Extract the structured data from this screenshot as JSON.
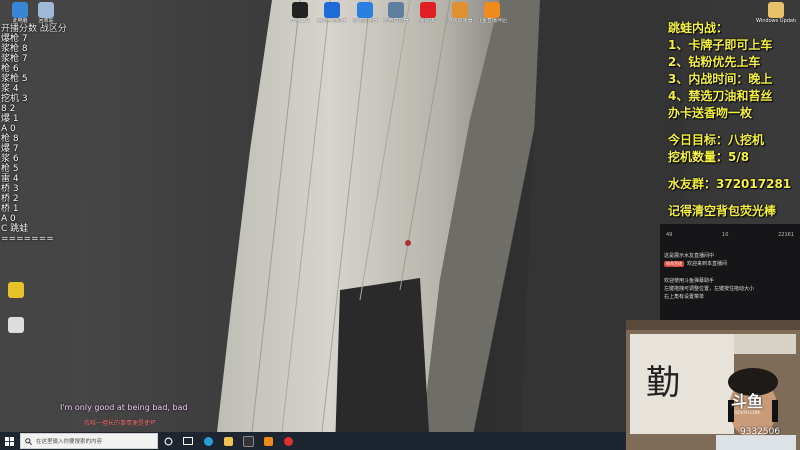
{
  "desktop": {
    "top_icons": [
      {
        "label": "此电脑",
        "color": "#3a86d6",
        "icon": "computer-icon"
      },
      {
        "label": "回收站",
        "color": "#9fb9d4",
        "icon": "recycle-bin-icon"
      },
      {
        "label": "开播工具",
        "color": "#222222",
        "icon": "app-icon"
      },
      {
        "label": "腾讯手游助手",
        "color": "#1e6ad6",
        "icon": "app-icon"
      },
      {
        "label": "雷神加速器",
        "color": "#2b7fe0",
        "icon": "app-icon"
      },
      {
        "label": "雷电模拟器",
        "color": "#5f7fa0",
        "icon": "app-icon"
      },
      {
        "label": "网易UU",
        "color": "#e02020",
        "icon": "app-icon"
      },
      {
        "label": "游戏加速器",
        "color": "#e09030",
        "icon": "app-icon"
      },
      {
        "label": "斗鱼直播伴侣",
        "color": "#f08a1c",
        "icon": "app-icon"
      }
    ],
    "right_icons": [
      {
        "label": "Windows Update 助手",
        "color": "#e8c26a",
        "icon": "folder-icon"
      }
    ],
    "side_icons": [
      {
        "label": "",
        "color": "#e8c22a",
        "icon": "app-icon"
      },
      {
        "label": "",
        "color": "#dddddd",
        "icon": "app-icon"
      }
    ]
  },
  "left_overlay": {
    "header": "开播分数 战区分",
    "rows": [
      "爆枪 7",
      "浆枪 8",
      "浆枪 7",
      "枪 6",
      "浆枪 5",
      "浆 4",
      "挖机 3",
      "8 2",
      "爆 1",
      "A 0",
      "枪 8",
      "爆 7",
      "浆 6",
      "枪 5",
      "雷 4",
      "桥 3",
      "桥 2",
      "桥 1",
      "A 0",
      "C 跳蛙",
      "======="
    ]
  },
  "right_overlay": {
    "lines_top": [
      "跳蛙内战：",
      "1、卡牌子即可上车",
      "2、钻粉优先上车",
      "3、内战时间：晚上",
      "4、禁选刀油和苔丝",
      "办卡送香吻一枚"
    ],
    "lines_mid": [
      "今日目标：八挖机",
      "挖机数量：5/8"
    ],
    "group": "水友群：372017281",
    "reminder": "记得清空背包荧光棒"
  },
  "chat": {
    "stats": [
      "49",
      "10",
      "22161"
    ],
    "msg_1": "这是展示水友直播间中",
    "welcome_badge": "纯命西佬",
    "welcome_text": "欢迎来到本直播间",
    "msg_2": "欢迎使用斗鱼弹幕助手",
    "msg_3": "左键拖拽可调整位置，左键按住拖动大小",
    "msg_4": "右上角有设置菜单"
  },
  "stream": {
    "logo": "斗鱼",
    "logo_sub": "DOUYU.COM",
    "room_number": "9332506"
  },
  "subtitles": {
    "english": "I'm only good at being bad, bad",
    "chinese": "我唯一擅长的事情便是使坏"
  },
  "taskbar": {
    "search_placeholder": "在这里输入你要搜索的内容",
    "apps": [
      {
        "name": "task-view-icon",
        "color": "#ffffff"
      },
      {
        "name": "edge-icon",
        "color": "#2d9cdb"
      },
      {
        "name": "file-explorer-icon",
        "color": "#f2c14e"
      },
      {
        "name": "app-icon",
        "color": "#333333"
      },
      {
        "name": "app-icon",
        "color": "#f08a1c"
      },
      {
        "name": "app-icon",
        "color": "#e03030"
      }
    ]
  },
  "colors": {
    "overlay_yellow": "#f4f040",
    "taskbar": "#1d2530"
  }
}
